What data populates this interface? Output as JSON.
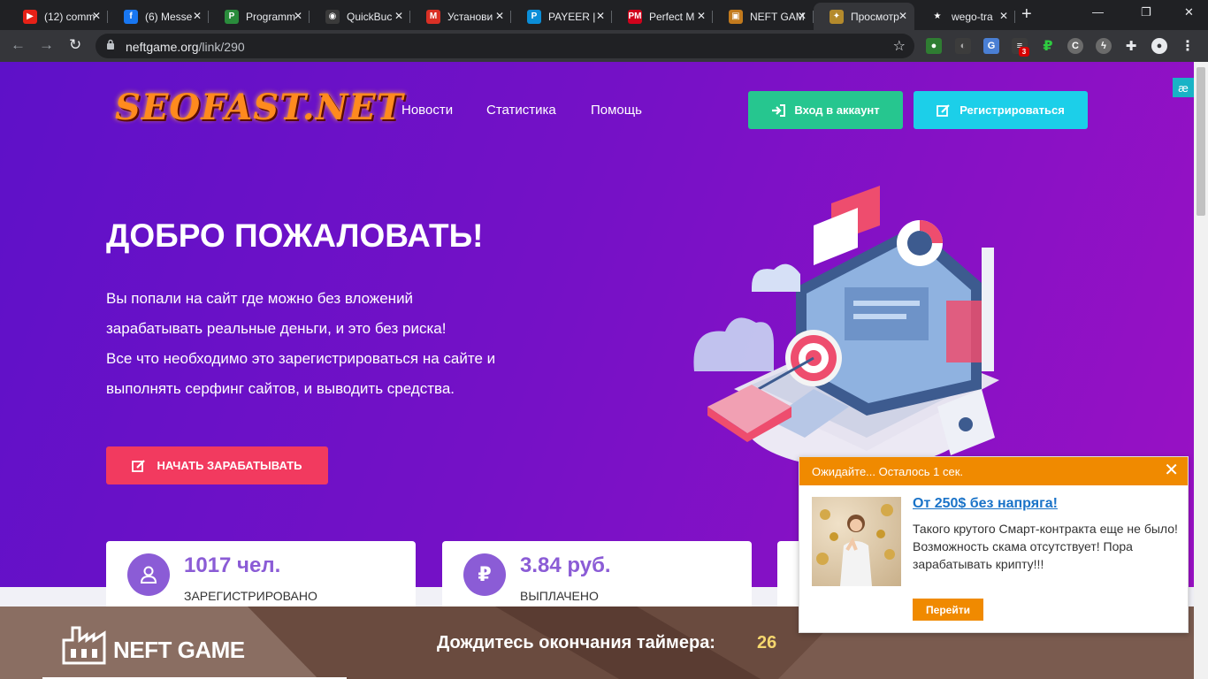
{
  "browser": {
    "tabs": [
      {
        "title": "(12) comm",
        "fav_color": "#e62117",
        "fav_glyph": "▶"
      },
      {
        "title": "(6) Messe",
        "fav_color": "#1877f2",
        "fav_glyph": "f"
      },
      {
        "title": "Programm",
        "fav_color": "#2a8c3c",
        "fav_glyph": "P"
      },
      {
        "title": "QuickBuc",
        "fav_color": "#3a3a3a",
        "fav_glyph": "◉"
      },
      {
        "title": "Установи",
        "fav_color": "#d93025",
        "fav_glyph": "M"
      },
      {
        "title": "PAYEER |",
        "fav_color": "#0b8ed8",
        "fav_glyph": "P"
      },
      {
        "title": "Perfect M",
        "fav_color": "#d0021b",
        "fav_glyph": "PM"
      },
      {
        "title": "NEFT GAM",
        "fav_color": "#c27a1d",
        "fav_glyph": "▣"
      },
      {
        "title": "Просмотр",
        "fav_color": "#b48a2c",
        "fav_glyph": "✦",
        "active": true
      },
      {
        "title": "wego-tra",
        "fav_color": "#202124",
        "fav_glyph": "★"
      }
    ],
    "url_domain": "neftgame.org",
    "url_path": "/link/290",
    "extension_badge": "3"
  },
  "site": {
    "logo": "SEOFAST.NET",
    "nav": [
      "Новости",
      "Статистика",
      "Помощь"
    ],
    "login_label": "Вход в аккаунт",
    "register_label": "Регистрироваться",
    "corner_badge": "æ",
    "hero_title": "ДОБРО ПОЖАЛОВАТЬ!",
    "hero_lines": [
      "Вы попали на сайт где можно без вложений",
      "зарабатывать реальные деньги, и это без риска!",
      "Все что необходимо это зарегистрироваться на сайте и",
      "выполнять серфинг сайтов, и выводить средства."
    ],
    "earn_label": "НАЧАТЬ ЗАРАБАТЫВАТЬ",
    "stats": [
      {
        "value": "1017 чел.",
        "label": "ЗАРЕГИСТРИРОВАНО",
        "icon": "user-icon"
      },
      {
        "value": "3.84 руб.",
        "label": "ВЫПЛАЧЕНО",
        "icon": "ruble-icon"
      }
    ]
  },
  "neft_bar": {
    "brand": "NEFT GAME",
    "timer_text": "Дождитесь окончания таймера:",
    "timer_value": "26"
  },
  "popup": {
    "header": "Ожидайте... Осталось 1 сек.",
    "title": "От 250$ без напряга!",
    "description": "Такого крутого Смарт-контракта еще не было! Возможность скама отсутствует! Пора зарабатывать крипту!!!",
    "button": "Перейти"
  },
  "colors": {
    "page_gradient_start": "#5e11c8",
    "page_gradient_end": "#9b11c4",
    "login_green": "#26c68f",
    "register_cyan": "#1ccfe9",
    "earn_red": "#f23a5f",
    "stat_purple": "#8b5cd6",
    "popup_orange": "#f08a00"
  }
}
